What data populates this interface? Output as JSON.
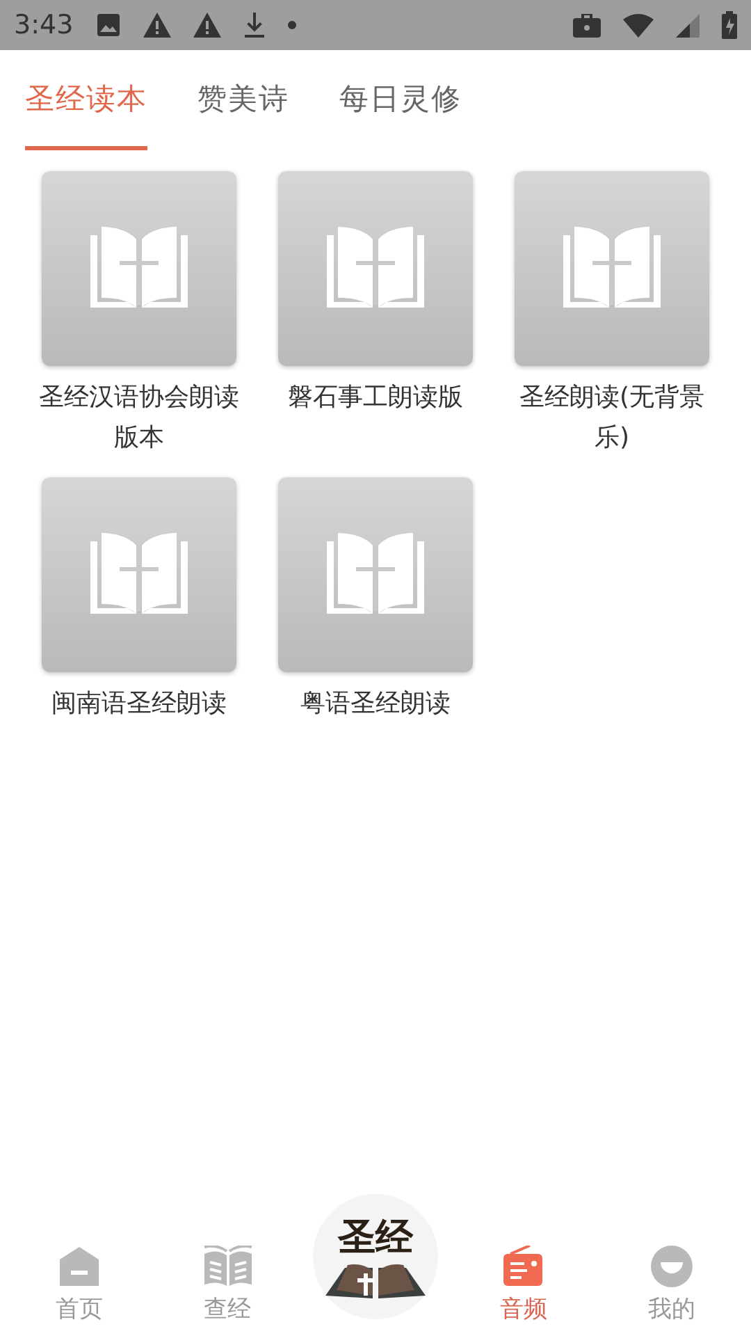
{
  "status_bar": {
    "time": "3:43"
  },
  "tabs": [
    {
      "label": "圣经读本",
      "selected": true
    },
    {
      "label": "赞美诗",
      "selected": false
    },
    {
      "label": "每日灵修",
      "selected": false
    }
  ],
  "books": [
    {
      "title": "圣经汉语协会朗读版本"
    },
    {
      "title": "磐石事工朗读版"
    },
    {
      "title": "圣经朗读(无背景乐)"
    },
    {
      "title": "闽南语圣经朗读"
    },
    {
      "title": "粤语圣经朗读"
    }
  ],
  "logo": {
    "text": "圣经"
  },
  "nav": [
    {
      "kind": "home",
      "label": "首页",
      "selected": false
    },
    {
      "kind": "search",
      "label": "查经",
      "selected": false
    },
    {
      "kind": "logo"
    },
    {
      "kind": "audio",
      "label": "音频",
      "selected": true
    },
    {
      "kind": "me",
      "label": "我的",
      "selected": false
    }
  ]
}
